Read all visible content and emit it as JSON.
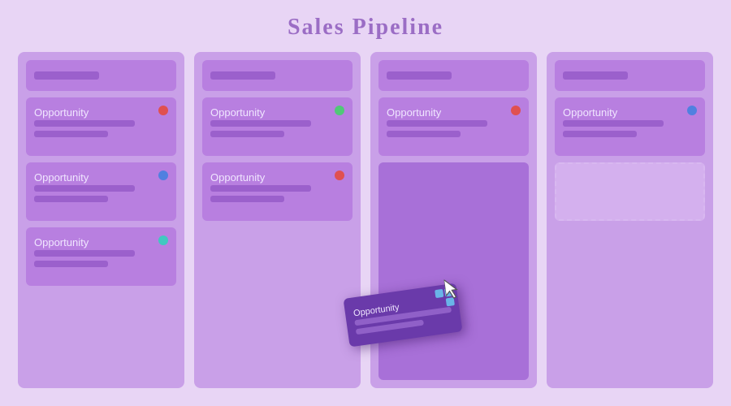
{
  "page": {
    "title": "Sales Pipeline",
    "background": "#e8d5f5"
  },
  "columns": [
    {
      "id": "col1",
      "header_label": "",
      "cards": [
        {
          "title": "Opportunity",
          "bar1": "short",
          "bar2": "shorter",
          "dot": "red"
        },
        {
          "title": "Opportunity",
          "bar1": "short",
          "bar2": "shorter",
          "dot": "blue"
        },
        {
          "title": "Opportunity",
          "bar1": "short",
          "bar2": "shorter",
          "dot": "teal"
        }
      ]
    },
    {
      "id": "col2",
      "header_label": "",
      "cards": [
        {
          "title": "Opportunity",
          "bar1": "short",
          "bar2": "shorter",
          "dot": "green"
        },
        {
          "title": "Opportunity",
          "bar1": "short",
          "bar2": "shorter",
          "dot": "red"
        }
      ]
    },
    {
      "id": "col3",
      "header_label": "",
      "cards": [
        {
          "title": "Opportunity",
          "bar1": "short",
          "bar2": "shorter",
          "dot": "red"
        }
      ],
      "has_placeholder": true
    },
    {
      "id": "col4",
      "header_label": "",
      "cards": [
        {
          "title": "Opportunity",
          "bar1": "short",
          "bar2": "shorter",
          "dot": "blue"
        }
      ],
      "has_drop_target": true
    }
  ],
  "drag_card": {
    "title": "Opportunity",
    "bar1": "short",
    "bar2": "shorter"
  }
}
